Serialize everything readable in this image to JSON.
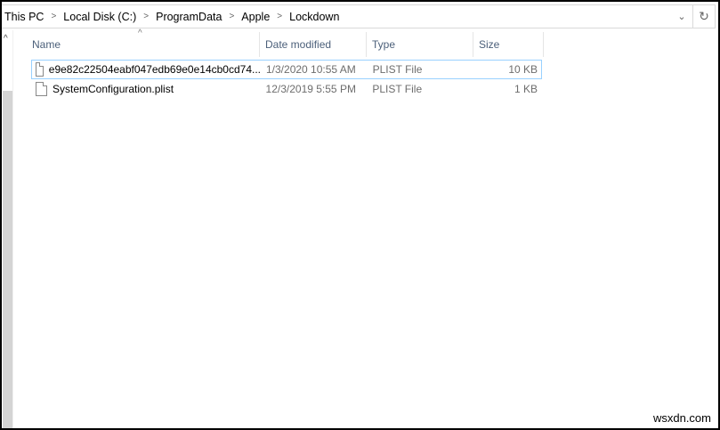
{
  "breadcrumb": [
    "This PC",
    "Local Disk (C:)",
    "ProgramData",
    "Apple",
    "Lockdown"
  ],
  "columns": {
    "name": "Name",
    "date": "Date modified",
    "type": "Type",
    "size": "Size"
  },
  "files": [
    {
      "name": "e9e82c22504eabf047edb69e0e14cb0cd74...",
      "date": "1/3/2020 10:55 AM",
      "type": "PLIST File",
      "size": "10 KB"
    },
    {
      "name": "SystemConfiguration.plist",
      "date": "12/3/2019 5:55 PM",
      "type": "PLIST File",
      "size": "1 KB"
    }
  ],
  "watermark": "wsxdn.com"
}
